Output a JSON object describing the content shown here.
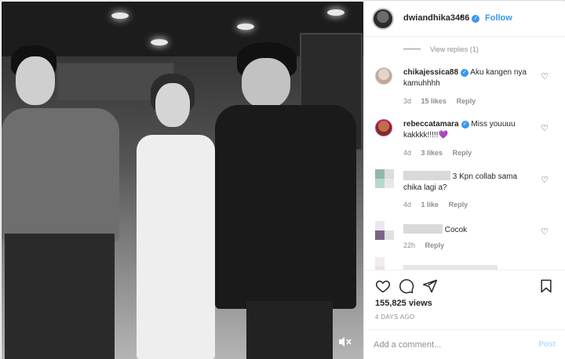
{
  "header": {
    "username": "dwiandhika3486",
    "separator": "•",
    "follow_label": "Follow",
    "verified_glyph": "✓"
  },
  "comments": {
    "view_replies": "View replies (1)",
    "items": [
      {
        "username": "chikajessica88",
        "verified": true,
        "text": "Aku kangen nya kamuhhhh",
        "age": "3d",
        "likes": "15 likes",
        "reply": "Reply"
      },
      {
        "username": "rebeccatamara",
        "verified": true,
        "text": "Miss youuuu kakkkk!!!!!💜",
        "age": "4d",
        "likes": "3 likes",
        "reply": "Reply"
      },
      {
        "username": "",
        "verified": false,
        "text": "3 Kpn collab sama chika lagi a?",
        "age": "4d",
        "likes": "1 like",
        "reply": "Reply"
      },
      {
        "username": "",
        "verified": false,
        "text": "Cocok",
        "age": "22h",
        "likes": "",
        "reply": "Reply"
      }
    ]
  },
  "actions": {
    "like_icon": "heart-outline-icon",
    "comment_icon": "comment-bubble-icon",
    "share_icon": "paper-plane-icon",
    "save_icon": "bookmark-icon",
    "views": "155,825 views",
    "posted": "4 DAYS AGO"
  },
  "composer": {
    "placeholder": "Add a comment...",
    "post_label": "Post"
  },
  "video": {
    "mute_icon": "speaker-muted-icon"
  },
  "colors": {
    "accent": "#3897f0",
    "muted_text": "#8e8e8e",
    "post_disabled": "#b2dffc"
  }
}
